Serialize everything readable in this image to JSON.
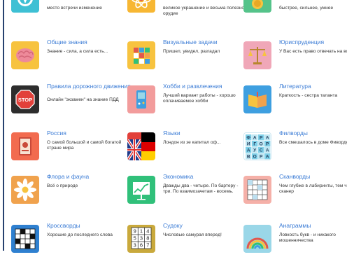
{
  "colors": {
    "title_blue": "#3a7bd5",
    "desc_text": "#333333",
    "rule": "#27416f"
  },
  "categories": [
    {
      "title": "",
      "desc": "место встречи изменение",
      "icon": "compass-icon",
      "color": "#3ec0d4"
    },
    {
      "title": "",
      "desc": "великое украшение и весьма полезное орудие",
      "icon": "atom-icon",
      "color": "#f7b733"
    },
    {
      "title": "",
      "desc": "быстрее, сильнее, умнее",
      "icon": "medal-icon",
      "color": "#55c38a"
    },
    {
      "title": "Общие знания",
      "desc": "Знание - сила, а сила есть...",
      "icon": "brain-icon",
      "color": "#f7c33f"
    },
    {
      "title": "Визуальные задачи",
      "desc": "Пришел, увидел, разгадал",
      "icon": "rubiks-cube-icon",
      "color": "#f7c33f"
    },
    {
      "title": "Юриспруденция",
      "desc": "У Вас есть право отвечать на вопросы",
      "icon": "scales-icon",
      "color": "#f0a7b8"
    },
    {
      "title": "Правила дорожного движения",
      "desc": "Онлайн \"экзамен\" на знание ПДД",
      "icon": "stop-sign-icon",
      "color": "#2d2d2d"
    },
    {
      "title": "Хобби и развлечения",
      "desc": "Лучший вариант работы - хорошо оплачиваемое хобби",
      "icon": "gamepad-icon",
      "color": "#f29c9c"
    },
    {
      "title": "Литература",
      "desc": "Краткость - сестра таланта",
      "icon": "open-book-icon",
      "color": "#3e9fe0"
    },
    {
      "title": "Россия",
      "desc": "О самой большой и самой богатой стране мира",
      "icon": "russia-book-icon",
      "color": "#f26b4f"
    },
    {
      "title": "Языки",
      "desc": "Лондон из зе капитал оф...",
      "icon": "flags-icon",
      "color": "#ffffff"
    },
    {
      "title": "Филворды",
      "desc": "Все смешалось в доме Фивордских",
      "icon": "letter-grid-icon",
      "color": "#ffffff",
      "letters": [
        "Ф",
        "А",
        "Р",
        "А",
        "И",
        "Г",
        "О",
        "Р",
        "А",
        "У",
        "С",
        "А",
        "В",
        "О",
        "Р",
        "А"
      ]
    },
    {
      "title": "Флора и фауна",
      "desc": "Всё о природе",
      "icon": "daisy-icon",
      "color": "#f0a24d"
    },
    {
      "title": "Экономика",
      "desc": "Дважды два - четыре. По бартеру - три. По взаимозачетам - восемь.",
      "icon": "growth-chart-icon",
      "color": "#30c07a"
    },
    {
      "title": "Сканворды",
      "desc": "Чем глубже в лабиринты, тем чище сканер",
      "icon": "scanword-grid-icon",
      "color": "#f5b0a8"
    },
    {
      "title": "Кроссворды",
      "desc": "Хорошие до последнего слова",
      "icon": "crossword-icon",
      "color": "#2f80d0"
    },
    {
      "title": "Судоку",
      "desc": "Числовые самурая вперед!",
      "icon": "sudoku-icon",
      "color": "#c9a93c",
      "digits": [
        "9",
        "1",
        "4",
        "5",
        "3",
        "8",
        "3",
        "6",
        "7"
      ]
    },
    {
      "title": "Анаграммы",
      "desc": "Ловкость букв - и никакого мошенничества",
      "icon": "rainbow-icon",
      "color": "#9ad7e8"
    }
  ]
}
